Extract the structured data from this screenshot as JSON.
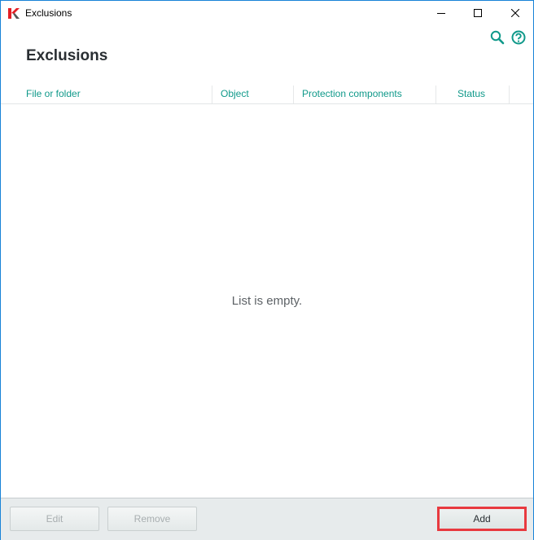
{
  "window": {
    "title": "Exclusions",
    "icons": {
      "app": "kaspersky-logo-icon",
      "minimize": "minimize-icon",
      "maximize": "maximize-icon",
      "close": "close-icon"
    }
  },
  "toolbar": {
    "search_icon": "search-icon",
    "help_icon": "help-icon",
    "accent_color": "#10998a"
  },
  "page": {
    "title": "Exclusions"
  },
  "table": {
    "columns": [
      {
        "label": "File or folder"
      },
      {
        "label": "Object"
      },
      {
        "label": "Protection components"
      },
      {
        "label": "Status"
      }
    ],
    "rows": [],
    "empty_text": "List is empty."
  },
  "footer": {
    "edit_label": "Edit",
    "remove_label": "Remove",
    "add_label": "Add",
    "highlight_color": "#e8393f"
  }
}
